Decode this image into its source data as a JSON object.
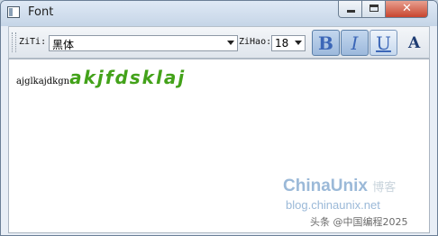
{
  "window": {
    "title": "Font",
    "close_glyph": "✕"
  },
  "toolbar": {
    "font_label": "ZiTi:",
    "font_value": "黑体",
    "size_label": "ZiHao:",
    "size_value": "18",
    "bold_glyph": "B",
    "italic_glyph": "I",
    "underline_glyph": "U",
    "color_glyph": "A",
    "bold_checked": true,
    "italic_checked": true,
    "underline_checked": false
  },
  "editor": {
    "text_small": "ajglkajdkgn",
    "text_large": "akjfdsklaj",
    "large_text_color": "#43a21a"
  },
  "watermark": {
    "brand": "ChinaUnix",
    "brand_cn": "博客",
    "url": "blog.chinaunix.net",
    "credit": "头条 @中国编程2025"
  }
}
